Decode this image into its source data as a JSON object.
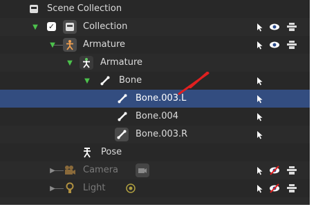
{
  "outliner": {
    "rows": [
      {
        "label": "Scene Collection"
      },
      {
        "label": "Collection"
      },
      {
        "label": "Armature"
      },
      {
        "label": "Armature"
      },
      {
        "label": "Bone"
      },
      {
        "label": "Bone.003.L"
      },
      {
        "label": "Bone.004"
      },
      {
        "label": "Bone.003.R"
      },
      {
        "label": "Pose"
      },
      {
        "label": "Camera"
      },
      {
        "label": "Light"
      }
    ]
  },
  "colors": {
    "background": "#282828",
    "selected_row": "#334d80",
    "expand_triangle": "#4cc24c",
    "annotation_mark": "#e02020",
    "hidden_eye_slash": "#e02020"
  }
}
